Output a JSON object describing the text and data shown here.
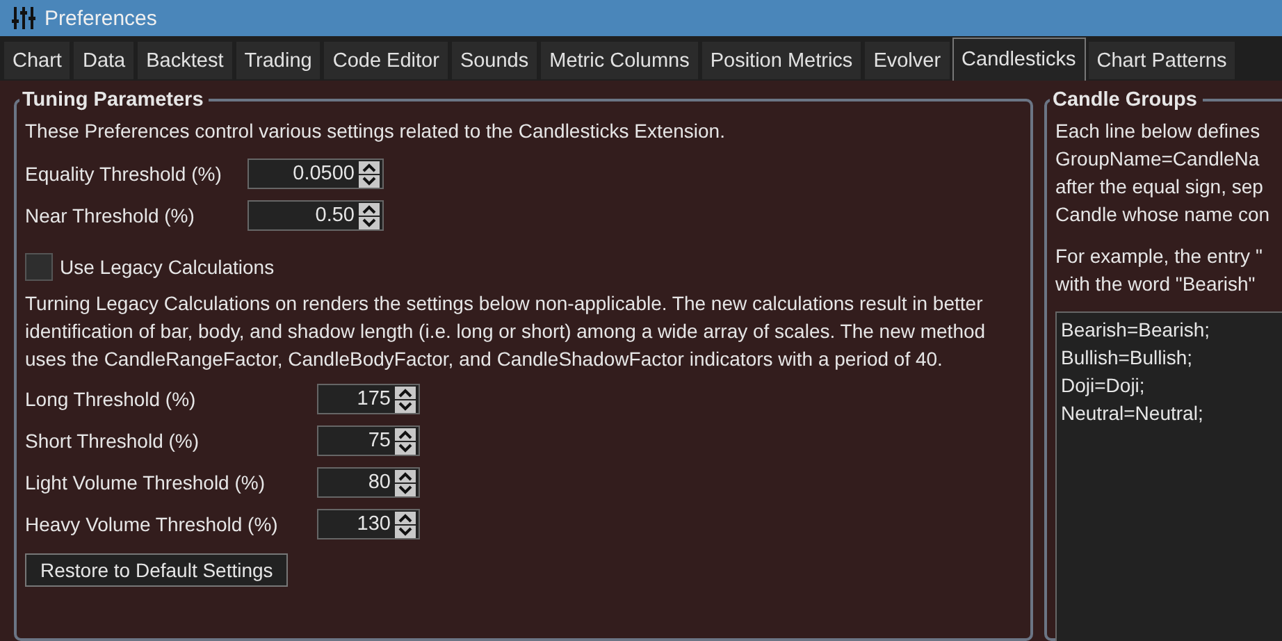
{
  "window": {
    "title": "Preferences"
  },
  "tabs": [
    {
      "label": "Chart",
      "selected": false
    },
    {
      "label": "Data",
      "selected": false
    },
    {
      "label": "Backtest",
      "selected": false
    },
    {
      "label": "Trading",
      "selected": false
    },
    {
      "label": "Code Editor",
      "selected": false
    },
    {
      "label": "Sounds",
      "selected": false
    },
    {
      "label": "Metric Columns",
      "selected": false
    },
    {
      "label": "Position Metrics",
      "selected": false
    },
    {
      "label": "Evolver",
      "selected": false
    },
    {
      "label": "Candlesticks",
      "selected": true
    },
    {
      "label": "Chart Patterns",
      "selected": false
    }
  ],
  "tuning": {
    "title": "Tuning Parameters",
    "intro": "These Preferences control various settings related to the Candlesticks Extension.",
    "top_fields": [
      {
        "label": "Equality Threshold (%)",
        "value": "0.0500"
      },
      {
        "label": "Near Threshold (%)",
        "value": "0.50"
      }
    ],
    "legacy": {
      "label": "Use Legacy Calculations",
      "checked": false
    },
    "note": "Turning Legacy Calculations on renders the settings below non-applicable. The new calculations result in better identification of bar, body, and shadow length (i.e. long or short) among a wide array of scales. The new method uses the CandleRangeFactor, CandleBodyFactor, and CandleShadowFactor indicators with a period of 40.",
    "fields": [
      {
        "label": "Long Threshold (%)",
        "value": "175"
      },
      {
        "label": "Short Threshold (%)",
        "value": "75"
      },
      {
        "label": "Light Volume Threshold (%)",
        "value": "80"
      },
      {
        "label": "Heavy Volume Threshold (%)",
        "value": "130"
      }
    ],
    "restore_button": "Restore to Default Settings"
  },
  "candle_groups": {
    "title": "Candle Groups",
    "description": [
      "Each line below defines",
      "GroupName=CandleNa",
      "after the equal sign, sep",
      "Candle whose name con"
    ],
    "example": [
      "For example, the entry \"",
      "with the word \"Bearish\""
    ],
    "lines": [
      "Bearish=Bearish;",
      "Bullish=Bullish;",
      "Doji=Doji;",
      "Neutral=Neutral;"
    ]
  }
}
